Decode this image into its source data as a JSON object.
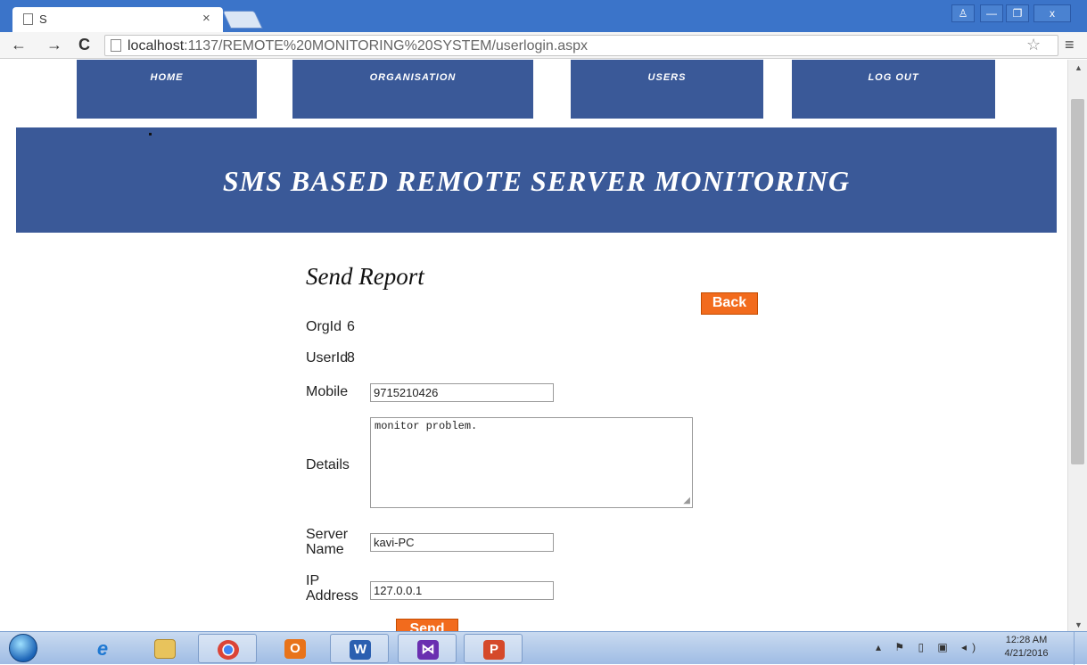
{
  "browser": {
    "tab_title": "S",
    "tab_close": "×",
    "url_host": "localhost",
    "url_path": ":1137/REMOTE%20MONITORING%20SYSTEM/userlogin.aspx",
    "back_glyph": "←",
    "forward_glyph": "→",
    "reload_glyph": "C",
    "star_glyph": "☆",
    "menu_glyph": "≡",
    "win_user": "♙",
    "win_min": "—",
    "win_restore": "❐",
    "win_close": "x"
  },
  "nav": {
    "home": "HOME",
    "organisation": "ORGANISATION",
    "users": "USERS",
    "logout": "LOG OUT"
  },
  "banner": {
    "title": "SMS BASED REMOTE  SERVER MONITORING"
  },
  "form": {
    "heading": "Send Report",
    "back_label": "Back",
    "orgid_label": "OrgId",
    "orgid_value": "6",
    "userid_label": "UserId",
    "userid_value": "8",
    "mobile_label": "Mobile",
    "mobile_value": "9715210426",
    "details_label": "Details",
    "details_value": "monitor problem.",
    "server_label_1": "Server",
    "server_label_2": "Name",
    "server_value": "kavi-PC",
    "ip_label_1": "IP",
    "ip_label_2": "Address",
    "ip_value": "127.0.0.1",
    "send_label": "Send"
  },
  "taskbar": {
    "apps": [
      "internet-explorer",
      "file-explorer",
      "chrome",
      "outlook",
      "word",
      "visual-studio",
      "powerpoint"
    ],
    "time": "12:28 AM",
    "date": "4/21/2016"
  },
  "colors": {
    "nav_blue": "#3a5998",
    "button_orange": "#f26b1d",
    "chrome_blue": "#3b74c9"
  }
}
